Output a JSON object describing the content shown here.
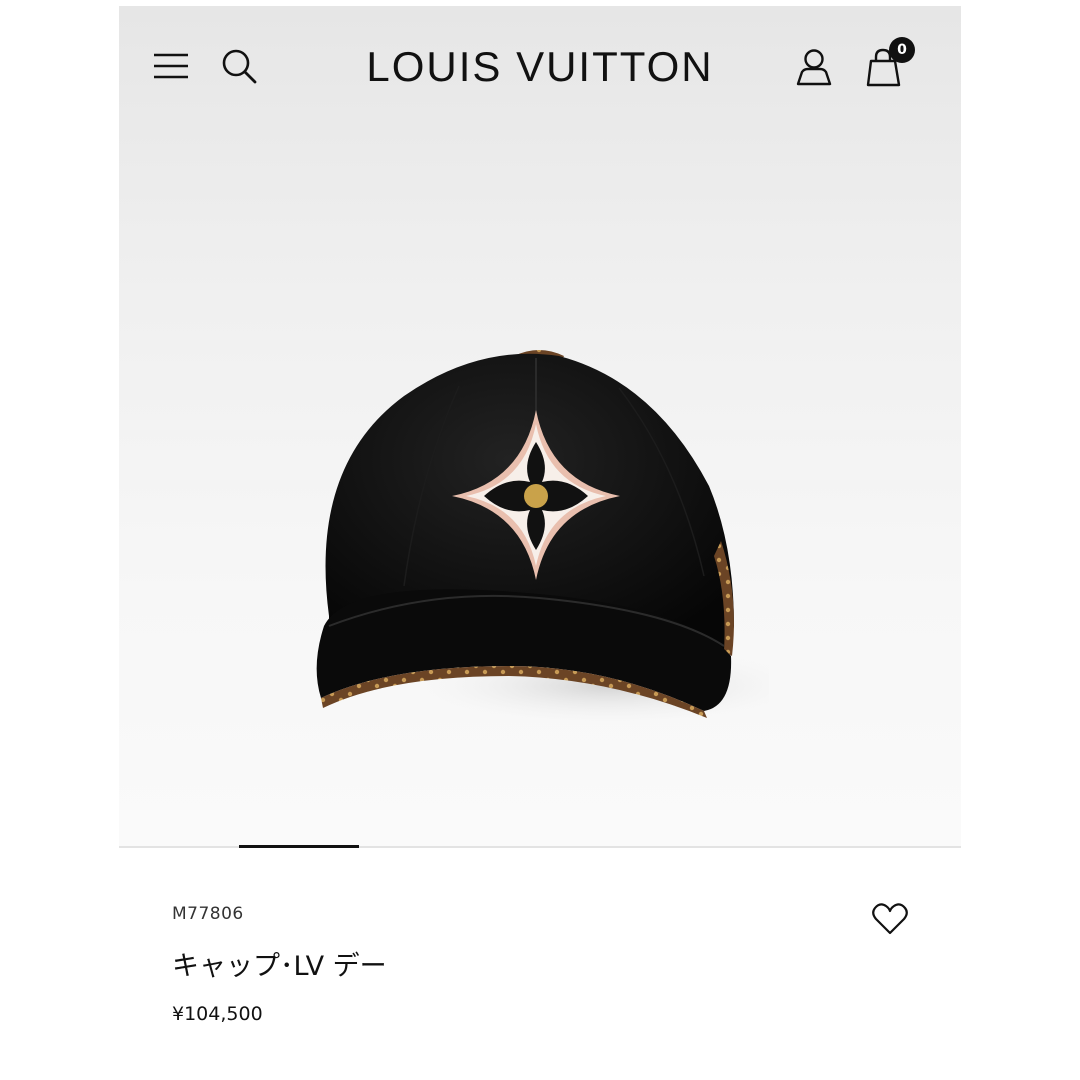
{
  "header": {
    "brand": "LOUIS VUITTON",
    "menu_icon": "hamburger-menu-icon",
    "search_icon": "search-icon",
    "account_icon": "user-icon",
    "bag_icon": "shopping-bag-icon",
    "bag_count": "0"
  },
  "gallery": {
    "active_index": 1,
    "colors": {
      "cap_black": "#111111",
      "emblem_pink": "#e9bfae",
      "emblem_cream": "#f7efe9",
      "flower_gold": "#c9a24a",
      "monogram_brown": "#6b4425"
    }
  },
  "product": {
    "sku": "M77806",
    "name": "キャップ･LV デー",
    "price": "¥104,500",
    "wishlist_icon": "heart-outline-icon"
  }
}
